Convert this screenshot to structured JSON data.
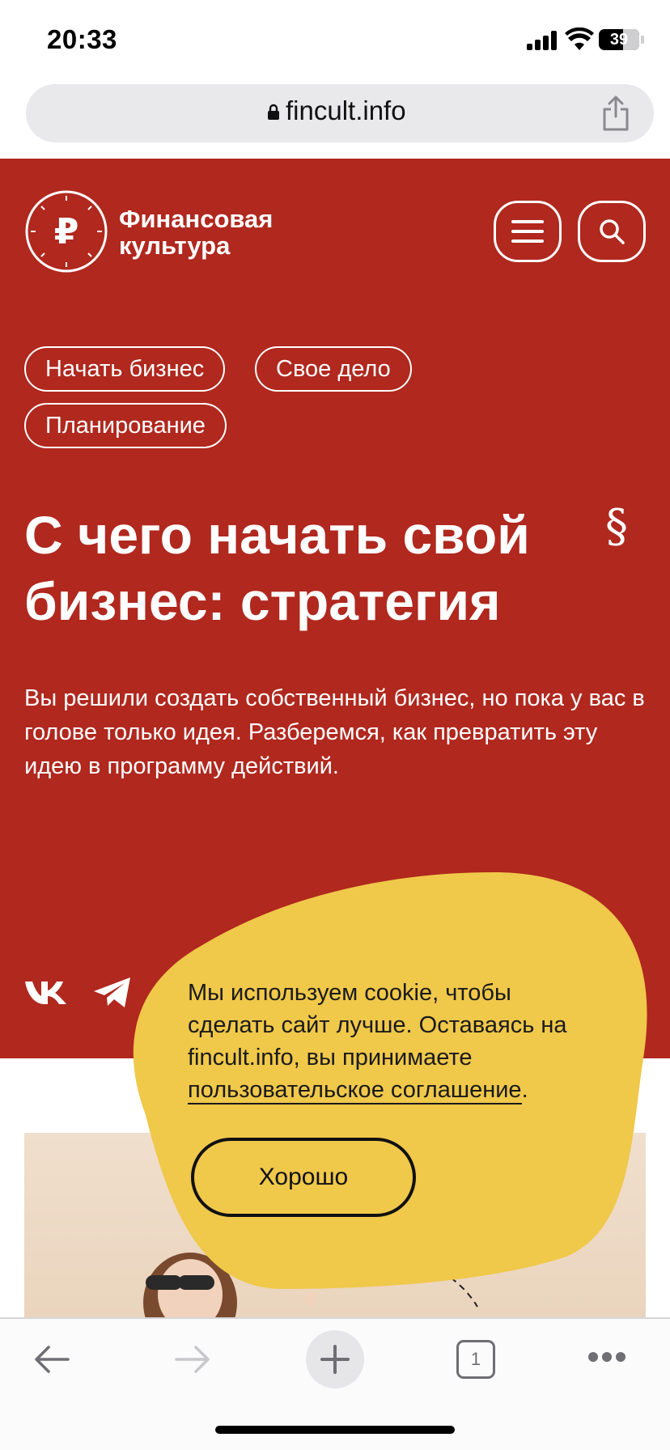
{
  "status_bar": {
    "time": "20:33",
    "battery": "39"
  },
  "browser": {
    "url": "fincult.info"
  },
  "site": {
    "logo_line1": "Финансовая",
    "logo_line2": "культура",
    "brand_color": "#b0281e"
  },
  "tags": [
    "Начать бизнес",
    "Свое дело",
    "Планирование"
  ],
  "article": {
    "title": "С чего начать свой бизнес: стратегия",
    "paragraph_mark": "§",
    "lead": "Вы решили создать собственный бизнес, но пока у вас в голове только идея. Разберемся, как превратить эту идею в программу действий."
  },
  "cookie": {
    "text_before_link": "Мы используем cookie, чтобы сделать сайт лучше. Оставаясь на fincult.info, вы принимаете ",
    "link_text": "пользовательское соглашение",
    "text_after_link": ".",
    "button_label": "Хорошо",
    "color": "#f0c84a"
  },
  "toolbar": {
    "tabs_count": "1"
  }
}
